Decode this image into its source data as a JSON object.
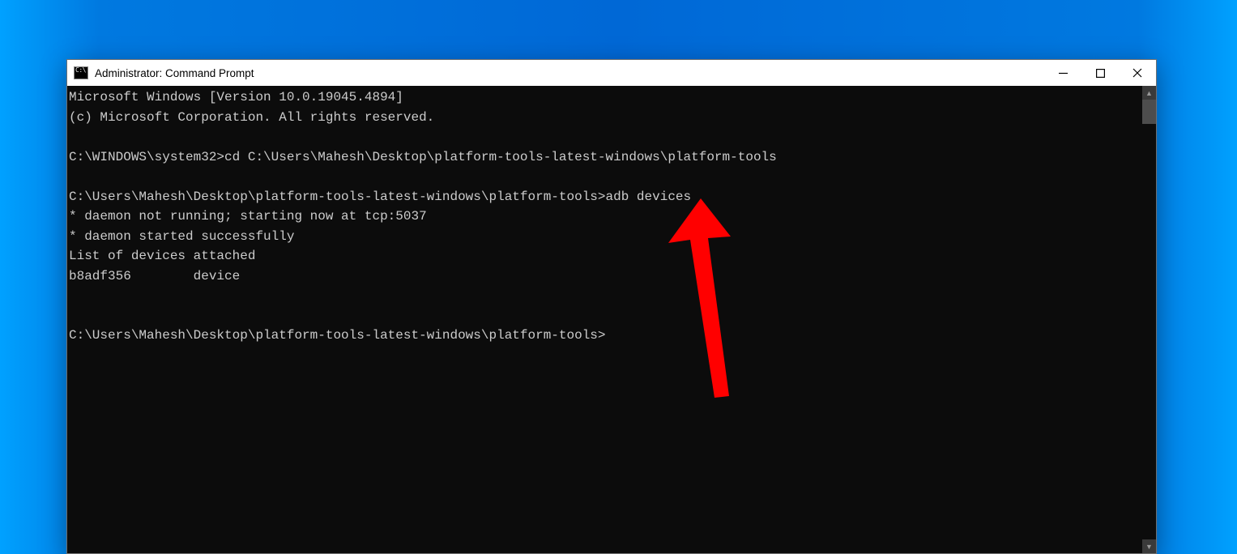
{
  "window": {
    "title": "Administrator: Command Prompt"
  },
  "terminal": {
    "line1": "Microsoft Windows [Version 10.0.19045.4894]",
    "line2": "(c) Microsoft Corporation. All rights reserved.",
    "blank1": "",
    "prompt1": "C:\\WINDOWS\\system32>",
    "cmd1": "cd C:\\Users\\Mahesh\\Desktop\\platform-tools-latest-windows\\platform-tools",
    "blank2": "",
    "prompt2": "C:\\Users\\Mahesh\\Desktop\\platform-tools-latest-windows\\platform-tools>",
    "cmd2": "adb devices",
    "out1": "* daemon not running; starting now at tcp:5037",
    "out2": "* daemon started successfully",
    "out3": "List of devices attached",
    "out4": "b8adf356        device",
    "blank3": "",
    "blank4": "",
    "prompt3": "C:\\Users\\Mahesh\\Desktop\\platform-tools-latest-windows\\platform-tools>"
  },
  "annotation": {
    "color": "#ff0000"
  }
}
